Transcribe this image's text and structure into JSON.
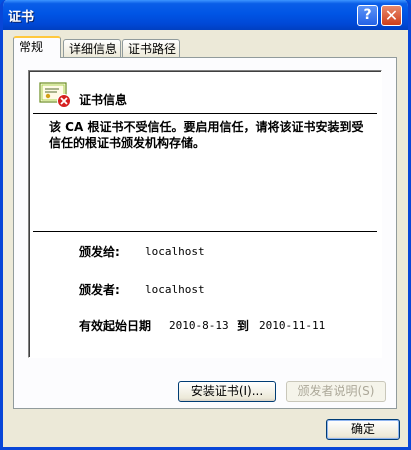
{
  "window": {
    "title": "证书"
  },
  "titlebar_buttons": {
    "help_glyph": "?",
    "close_glyph": "✕"
  },
  "tabs": [
    {
      "label": "常规"
    },
    {
      "label": "详细信息"
    },
    {
      "label": "证书路径"
    }
  ],
  "certificate": {
    "heading": "证书信息",
    "warning": "该 CA 根证书不受信任。要启用信任，请将该证书安装到受信任的根证书颁发机构存储。",
    "issued_to_label": "颁发给:",
    "issued_to_value": "localhost",
    "issued_by_label": "颁发者:",
    "issued_by_value": "localhost",
    "valid_from_label": "有效起始日期",
    "valid_from_value": "2010-8-13",
    "valid_to_label": "到",
    "valid_to_value": "2010-11-11"
  },
  "buttons": {
    "install": "安装证书(I)...",
    "issuer_statement": "颁发者说明(S)",
    "ok": "确定"
  },
  "icons": {
    "certificate": "certificate-icon",
    "error_badge": "error-x-icon"
  },
  "colors": {
    "titlebar": "#0055e5",
    "dialog_bg": "#ece9d8",
    "tab_highlight": "#ffc83c"
  }
}
